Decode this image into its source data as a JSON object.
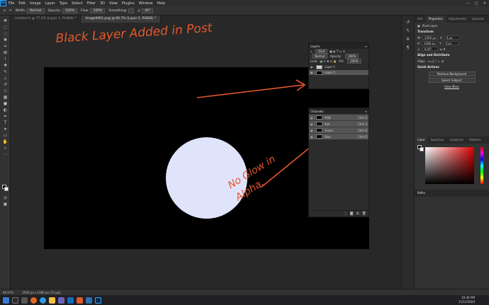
{
  "app": {
    "logo": "Ps"
  },
  "menu": [
    "File",
    "Edit",
    "Image",
    "Layer",
    "Type",
    "Select",
    "Filter",
    "3D",
    "View",
    "Plugins",
    "Window",
    "Help"
  ],
  "options": {
    "width_label": "Width:",
    "width_value": "Normal",
    "opacity_label": "Opacity:",
    "opacity_value": "100%",
    "flow_label": "Flow:",
    "flow_value": "100%",
    "smoothing_label": "Smoothing:",
    "angle_value": "40°"
  },
  "tabs": [
    {
      "label": "Untitled-1 @ 77.2% (Layer 1, RGB/8) *"
    },
    {
      "label": "Image0001.png @ 66.7% (Layer 2, RGB/8) *"
    }
  ],
  "annotations": {
    "top": "Black Layer Added in Post",
    "bottom_line1": "No Glow in",
    "bottom_line2": "Alpha."
  },
  "layers_panel": {
    "title": "Layers",
    "kind_label": "Kind",
    "mode_value": "Normal",
    "opacity_label": "Opacity:",
    "opacity_value": "100%",
    "lock_label": "Lock:",
    "fill_label": "Fill:",
    "fill_value": "100%",
    "layers": [
      {
        "name": "Layer 1",
        "selected": false,
        "thumb": "checker"
      },
      {
        "name": "Layer 2",
        "selected": true,
        "thumb": "black"
      }
    ]
  },
  "channels_panel": {
    "title": "Channels",
    "channels": [
      {
        "name": "RGB",
        "shortcut": "Ctrl+2",
        "color": "#ffffff"
      },
      {
        "name": "Red",
        "shortcut": "Ctrl+3",
        "color": "#ff3030"
      },
      {
        "name": "Green",
        "shortcut": "Ctrl+4",
        "color": "#30ff30"
      },
      {
        "name": "Blue",
        "shortcut": "Ctrl+5",
        "color": "#3060ff"
      }
    ]
  },
  "properties": {
    "tabs": [
      "Info",
      "Properties",
      "Adjustments",
      "Libraries"
    ],
    "active_tab": "Properties",
    "kind": "Pixel Layer",
    "transform_title": "Transform",
    "w_value": "2500 px",
    "h_value": "1080 px",
    "x_value": "0 px",
    "y_value": "0 px",
    "angle_value": "0.00°",
    "align_title": "Align and Distribute",
    "align_sub": "Align:",
    "quick_actions_title": "Quick Actions",
    "btn_remove_bg": "Remove Background",
    "btn_select_subject": "Select Subject",
    "link_view_more": "View More"
  },
  "color_panel": {
    "tabs": [
      "Color",
      "Swatches",
      "Gradients",
      "Patterns"
    ]
  },
  "paths_panel": {
    "title": "Paths"
  },
  "status": {
    "zoom": "66.67%",
    "doc_size": "3500 px x 1080 px (72 ppi)"
  },
  "clock": {
    "time": "10:30 AM",
    "date": "11/12/2024"
  }
}
